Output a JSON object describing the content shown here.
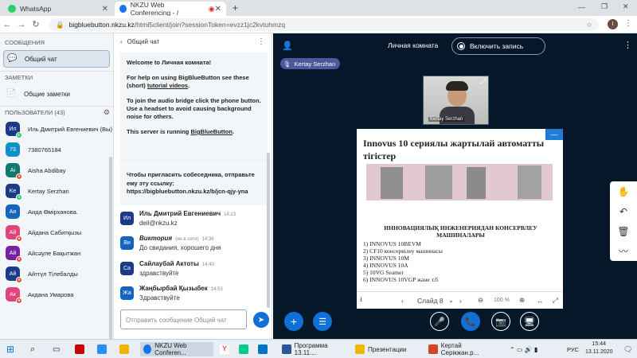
{
  "browser": {
    "tabs": [
      {
        "title": "WhatsApp",
        "active": false,
        "color": "#25d366"
      },
      {
        "title": "NKZU Web Conferencing - /",
        "active": true,
        "color": "#1a73e8"
      }
    ],
    "new_tab": "+",
    "url_host": "bigbluebutton.nkzu.kz",
    "url_path": "/html5client/join?sessionToken=evzz1jc2kvtuhmzq",
    "avatar_letter": "I"
  },
  "sidebar": {
    "messages_header": "СООБЩЕНИЯ",
    "public_chat": "Общий чат",
    "notes_header": "ЗАМЕТКИ",
    "shared_notes": "Общие заметки",
    "users_header": "ПОЛЬЗОВАТЕЛИ (43)",
    "users": [
      {
        "initials": "Ил",
        "name": "Иль Дмитрий Евгениевич (Вы)",
        "color": "#1d3a8a"
      },
      {
        "initials": "73",
        "name": "7380765184",
        "color": "#0d8fc8"
      },
      {
        "initials": "Ai",
        "name": "Aisha Abdibay",
        "color": "#0e7a6d"
      },
      {
        "initials": "Ke",
        "name": "Kertay Serzhan",
        "color": "#1d3a8a"
      },
      {
        "initials": "Аи",
        "name": "Аида Өмірханова.",
        "color": "#1564c0"
      },
      {
        "initials": "Ай",
        "name": "Айдана Сабитқызы",
        "color": "#e0447a"
      },
      {
        "initials": "Ай",
        "name": "Айсәуле Бақытжан",
        "color": "#7b1fa2"
      },
      {
        "initials": "Ай",
        "name": "Айтгүл Тілебалды",
        "color": "#1d3a8a"
      },
      {
        "initials": "Ак",
        "name": "Акдана Умарова",
        "color": "#e0447a"
      }
    ]
  },
  "chat": {
    "title": "Общий чат",
    "welcome_line1_prefix": "Welcome to ",
    "welcome_room": "Личная комната",
    "welcome_line1_suffix": "!",
    "welcome_help": "For help on using BigBlueButton see these (short) ",
    "welcome_help_link": "tutorial videos",
    "welcome_help_end": ".",
    "welcome_audio": "To join the audio bridge click the phone button. Use a headset to avoid causing background noise for others.",
    "welcome_server_prefix": "This server is running ",
    "welcome_server_link": "BigBlueButton",
    "welcome_server_end": ".",
    "invite": "Чтобы пригласить собеседника, отправьте ему эту ссылку: https://bigbluebutton.nkzu.kz/b/jcn-qjy-yna",
    "messages": [
      {
        "initials": "Ил",
        "name": "Иль Дмитрий Евгениевич",
        "time": "14:23",
        "text": "deil@nkzu.kz",
        "color": "#1d3a8a",
        "italic": false,
        "note": ""
      },
      {
        "initials": "Ви",
        "name": "Виктория",
        "time": "14:36",
        "text": "До свидания, хорошего дня",
        "color": "#1564c0",
        "italic": true,
        "note": "(не в сети)"
      },
      {
        "initials": "Са",
        "name": "Сайлаубай Актоты",
        "time": "14:40",
        "text": "здравствуйте",
        "color": "#1d3a8a",
        "italic": false,
        "note": ""
      },
      {
        "initials": "Жа",
        "name": "Жаңбырбай Қызыбек",
        "time": "14:53",
        "text": "Здравствуйте",
        "color": "#1564c0",
        "italic": false,
        "note": ""
      }
    ],
    "input_placeholder": "Отправить сообщение Общий чат"
  },
  "meeting": {
    "room_name": "Личная комната",
    "record_label": "Включить запись",
    "talker": "Kertay Serzhan",
    "camera_name": "Kertay Serzhan",
    "slide": {
      "title": "Innovus 10 сериялы жартылай автоматты тігістер",
      "subtitle": "ИННОВАЦИЯЛЫҚ ИНЖЕНЕРИЯДАН КОНСЕРВЛЕУ МАШИНАЛАРЫ",
      "items": [
        "1)  INNOVUS 10BEVM",
        "2)   CF10 консервілеу машинасы",
        "3)  INNOVUS 10M",
        "4)   INNOVUS 10A",
        "5)  10VG Seamer",
        "6)  INNOVUS 10VGP және т.б"
      ],
      "page": "Слайд 8",
      "zoom": "100 %"
    }
  },
  "taskbar": {
    "items": [
      {
        "label": "NKZU Web Conferen...",
        "color": "#1a73e8"
      },
      {
        "label": "Программа 13.11....",
        "color": "#2b579a"
      },
      {
        "label": "Презентации",
        "color": "#f2b600"
      },
      {
        "label": "Кертай Серікжан.р...",
        "color": "#d24726"
      }
    ],
    "lang": "РУС",
    "time": "15:44",
    "date": "13.11.2020"
  }
}
